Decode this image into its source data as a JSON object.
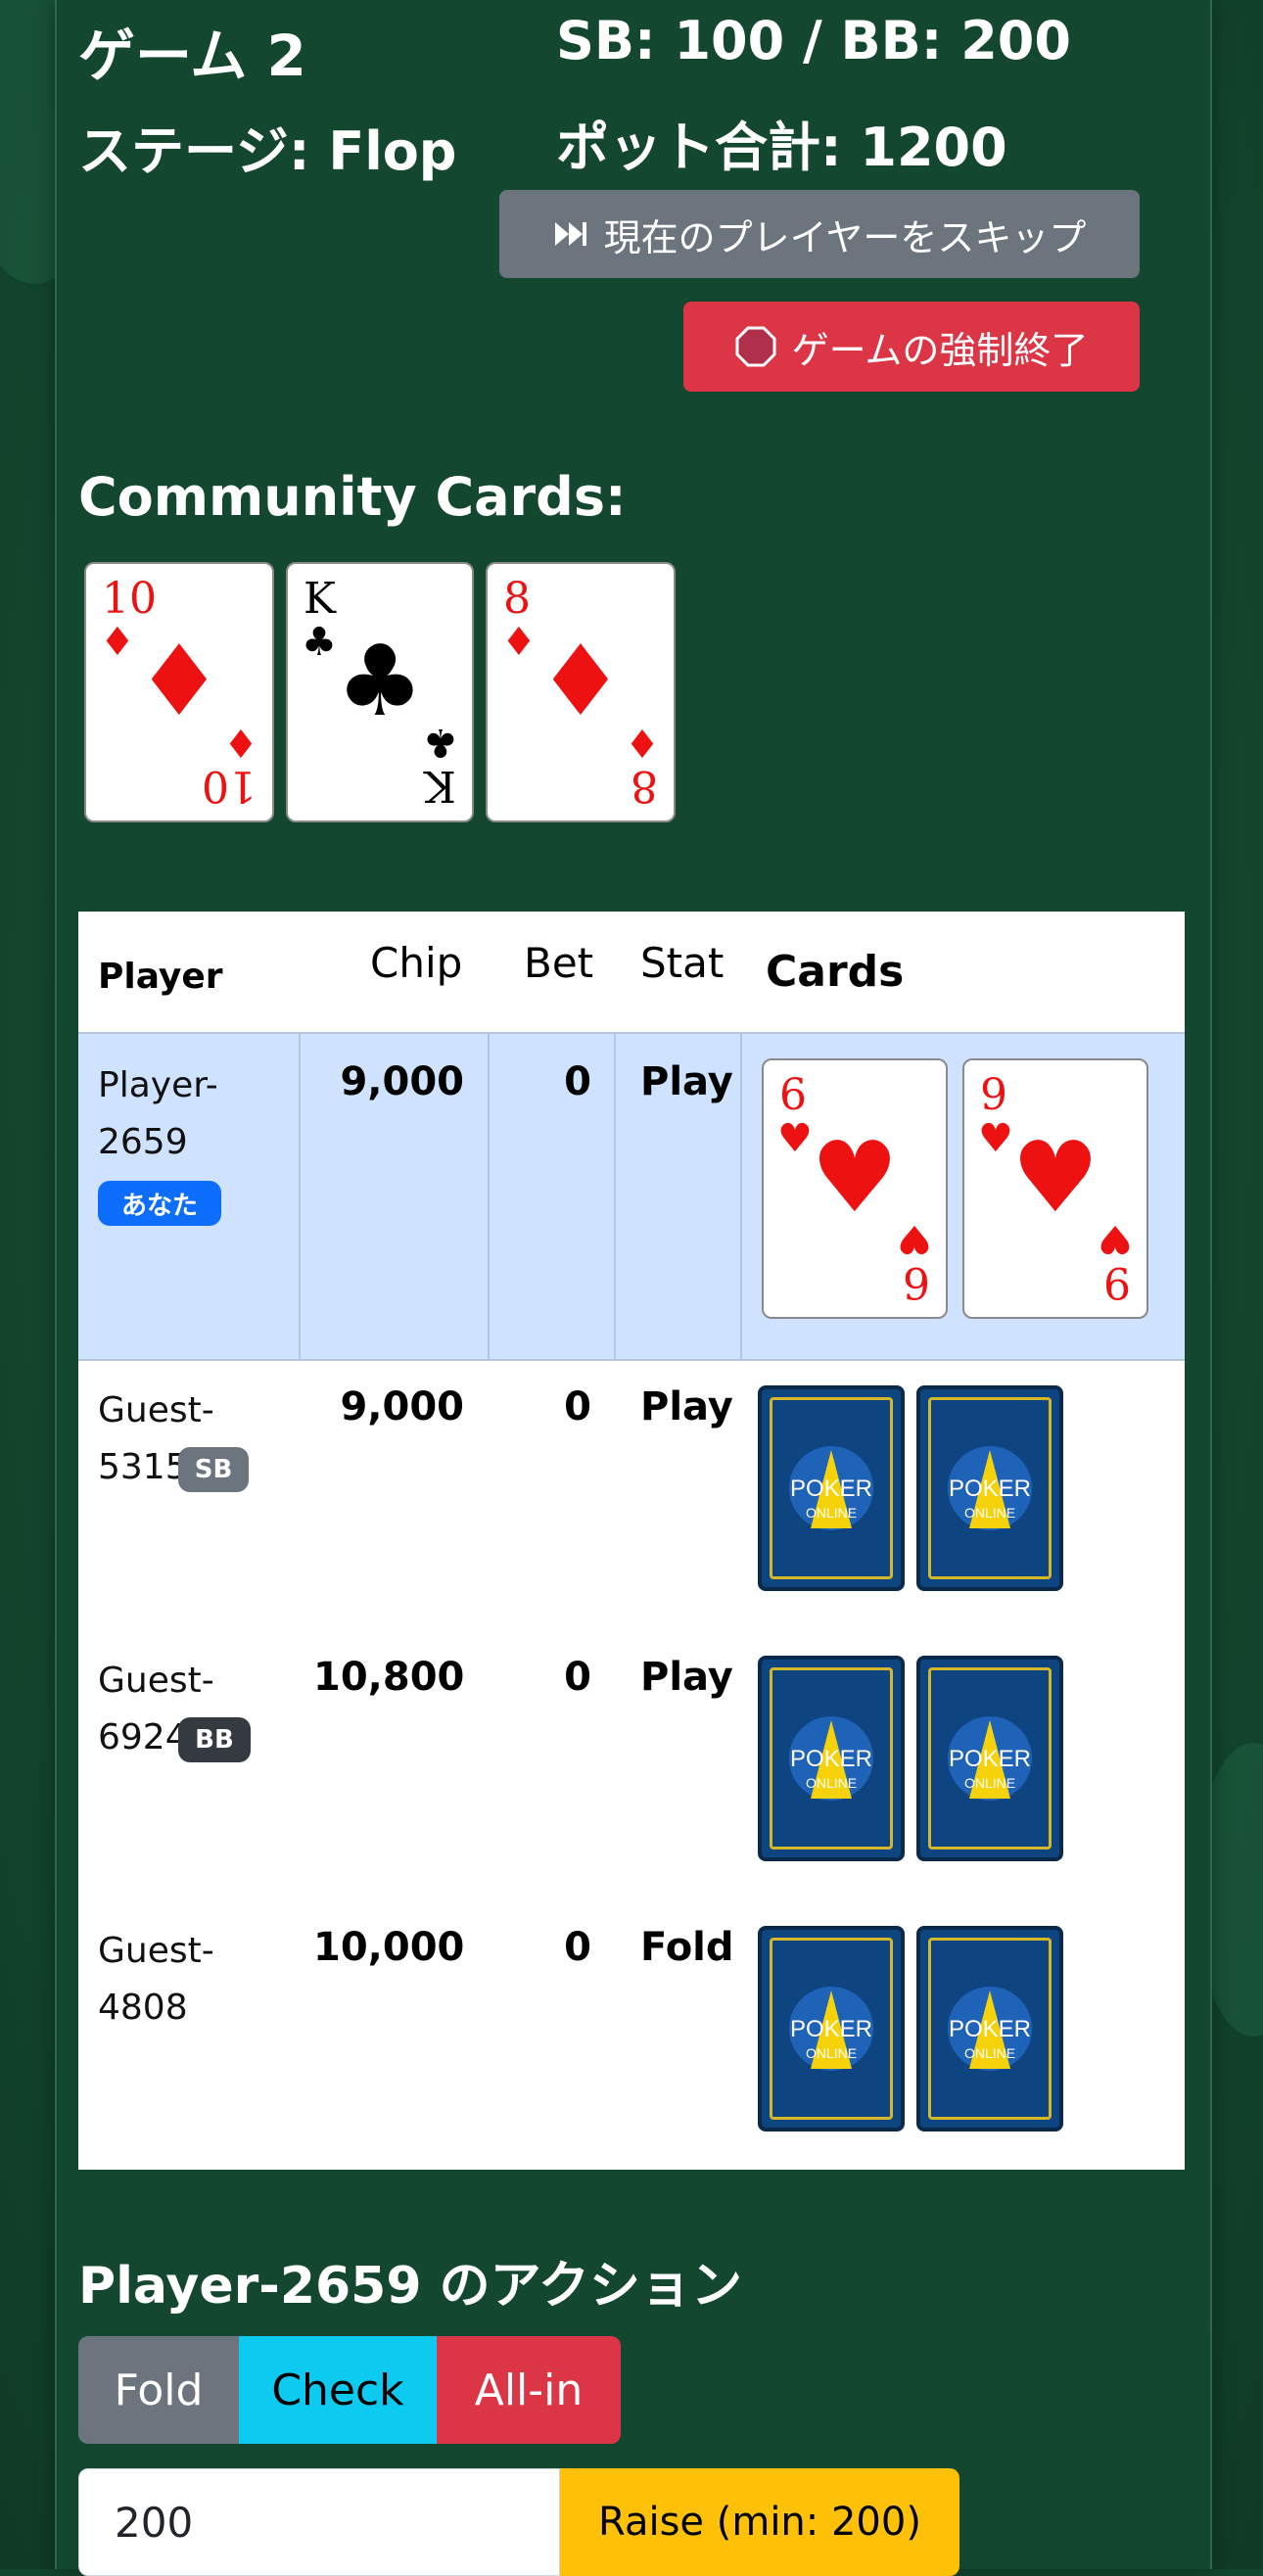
{
  "header": {
    "game_title": "ゲーム 2",
    "stage_label": "ステージ: Flop",
    "blinds": "SB: 100 / BB: 200",
    "pot_total": "ポット合計: 1200",
    "skip_button": "現在のプレイヤーをスキップ",
    "force_end_button": "ゲームの強制終了"
  },
  "community": {
    "title": "Community Cards:",
    "cards": [
      {
        "rank": "10",
        "suit": "♦",
        "color": "red"
      },
      {
        "rank": "K",
        "suit": "♣",
        "color": "black"
      },
      {
        "rank": "8",
        "suit": "♦",
        "color": "red"
      }
    ]
  },
  "table": {
    "headers": {
      "player": "Player",
      "chip": "Chip",
      "bet": "Bet",
      "stat": "Stat",
      "cards": "Cards"
    },
    "rows": [
      {
        "name_line1": "Player-",
        "name_line2": "2659",
        "badge": "あなた",
        "chip": "9,000",
        "bet": "0",
        "stat": "Play",
        "cards": [
          {
            "rank": "6",
            "suit": "♥"
          },
          {
            "rank": "9",
            "suit": "♥"
          }
        ]
      },
      {
        "name_line1": "Guest-",
        "name_line2": "5315",
        "badge": "SB",
        "chip": "9,000",
        "bet": "0",
        "stat": "Play"
      },
      {
        "name_line1": "Guest-",
        "name_line2": "6924",
        "badge": "BB",
        "chip": "10,800",
        "bet": "0",
        "stat": "Play"
      },
      {
        "name_line1": "Guest-",
        "name_line2": "4808",
        "badge": "",
        "chip": "10,000",
        "bet": "0",
        "stat": "Fold"
      }
    ],
    "card_back": {
      "line1": "POKER",
      "line2": "ONLINE"
    }
  },
  "action": {
    "title": "Player-2659 のアクション",
    "fold": "Fold",
    "check": "Check",
    "allin": "All-in",
    "raise_value": "200",
    "raise_button": "Raise (min: 200)"
  },
  "colors": {
    "felt": "#12452e",
    "secondary": "#6c757d",
    "danger": "#dc3545",
    "info": "#0dcaf0",
    "warning": "#ffc107",
    "primary_badge": "#0d6efd",
    "highlight_row": "#cfe2ff"
  }
}
